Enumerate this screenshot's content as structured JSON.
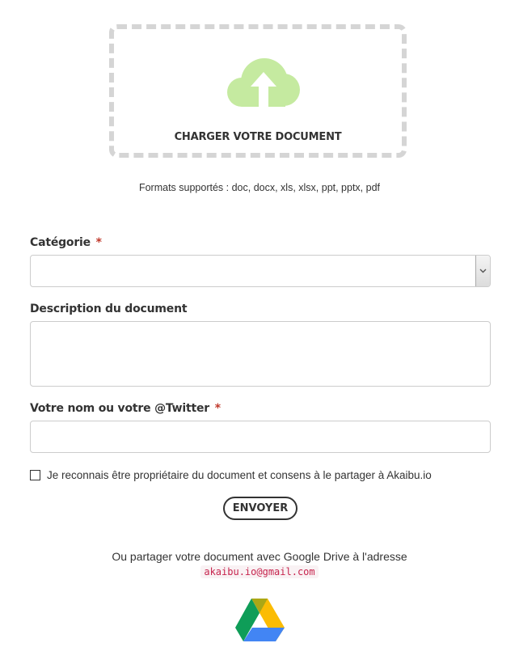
{
  "upload": {
    "label": "CHARGER VOTRE DOCUMENT",
    "icon": "cloud-upload-icon",
    "icon_color": "#c5eaa0",
    "formats": "Formats supportés : doc, docx, xls, xlsx, ppt, pptx, pdf"
  },
  "form": {
    "category": {
      "label": "Catégorie",
      "required_mark": "*",
      "value": ""
    },
    "description": {
      "label": "Description du document",
      "value": ""
    },
    "name": {
      "label": "Votre nom ou votre @Twitter",
      "required_mark": "*",
      "value": ""
    },
    "consent": {
      "label": "Je reconnais être propriétaire du document et consens à le partager à Akaibu.io",
      "checked": false
    },
    "submit_label": "ENVOYER"
  },
  "share": {
    "text": "Ou partager votre document avec Google Drive à l'adresse",
    "email": "akaibu.io@gmail.com",
    "icon": "google-drive-icon"
  },
  "colors": {
    "required": "#c0392b",
    "email_text": "#c7254e",
    "email_bg": "#f9f2f4"
  }
}
